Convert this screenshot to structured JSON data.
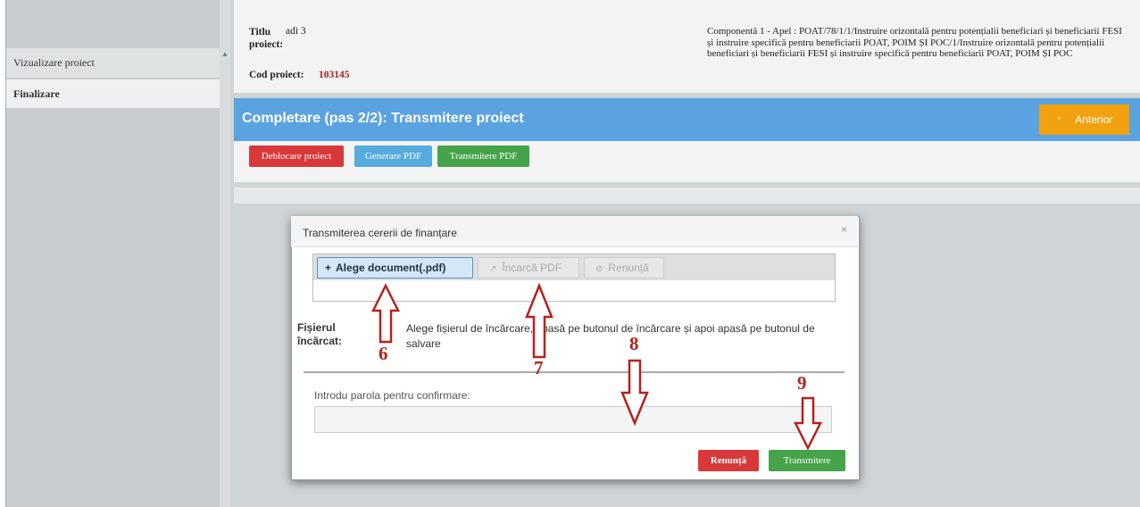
{
  "sidebar": {
    "items": [
      {
        "label": "Vizualizare proiect"
      },
      {
        "label": "Finalizare"
      }
    ]
  },
  "header": {
    "title_label": "Titlu proiect:",
    "title_value": "adi 3",
    "code_label": "Cod proiect:",
    "code_value": "103145",
    "description": "Componentă 1 - Apel : POAT/78/1/1/Instruire orizontală pentru potențialii beneficiari și beneficiarii FESI și instruire specifică pentru beneficiarii POAT, POIM ȘI POC/1/Instruire orizontală pentru potențialii beneficiari și beneficiarii FESI și instruire specifică pentru beneficiarii POAT, POIM ȘI POC"
  },
  "titlebar": {
    "text": "Completare (pas 2/2): Transmitere proiect",
    "back_label": "Anterior",
    "back_icon": "chevron-up-icon"
  },
  "actions": {
    "unlock": "Deblocare proiect",
    "generate_pdf": "Generare PDF",
    "send_pdf": "Transmitere PDF"
  },
  "modal": {
    "title": "Transmiterea cererii de finanțare",
    "close": "×",
    "choose_doc": "Alege document(.pdf)",
    "upload_pdf": "Încarcă PDF",
    "cancel_upload": "Renunță",
    "file_label": "Fișierul încărcat:",
    "file_help": "Alege fișierul de încărcare, apasă pe butonul de încărcare și apoi apasă pe butonul de salvare",
    "password_label": "Introdu parola pentru confirmare:",
    "cancel": "Renunță",
    "submit": "Transmitere"
  },
  "annotations": [
    "6",
    "7",
    "8",
    "9"
  ],
  "colors": {
    "titlebar": "#5aa3e0",
    "anterior": "#f1a10f",
    "danger": "#d9383a",
    "info": "#56acdd",
    "success": "#45a34a",
    "annotation": "#b2221d"
  }
}
